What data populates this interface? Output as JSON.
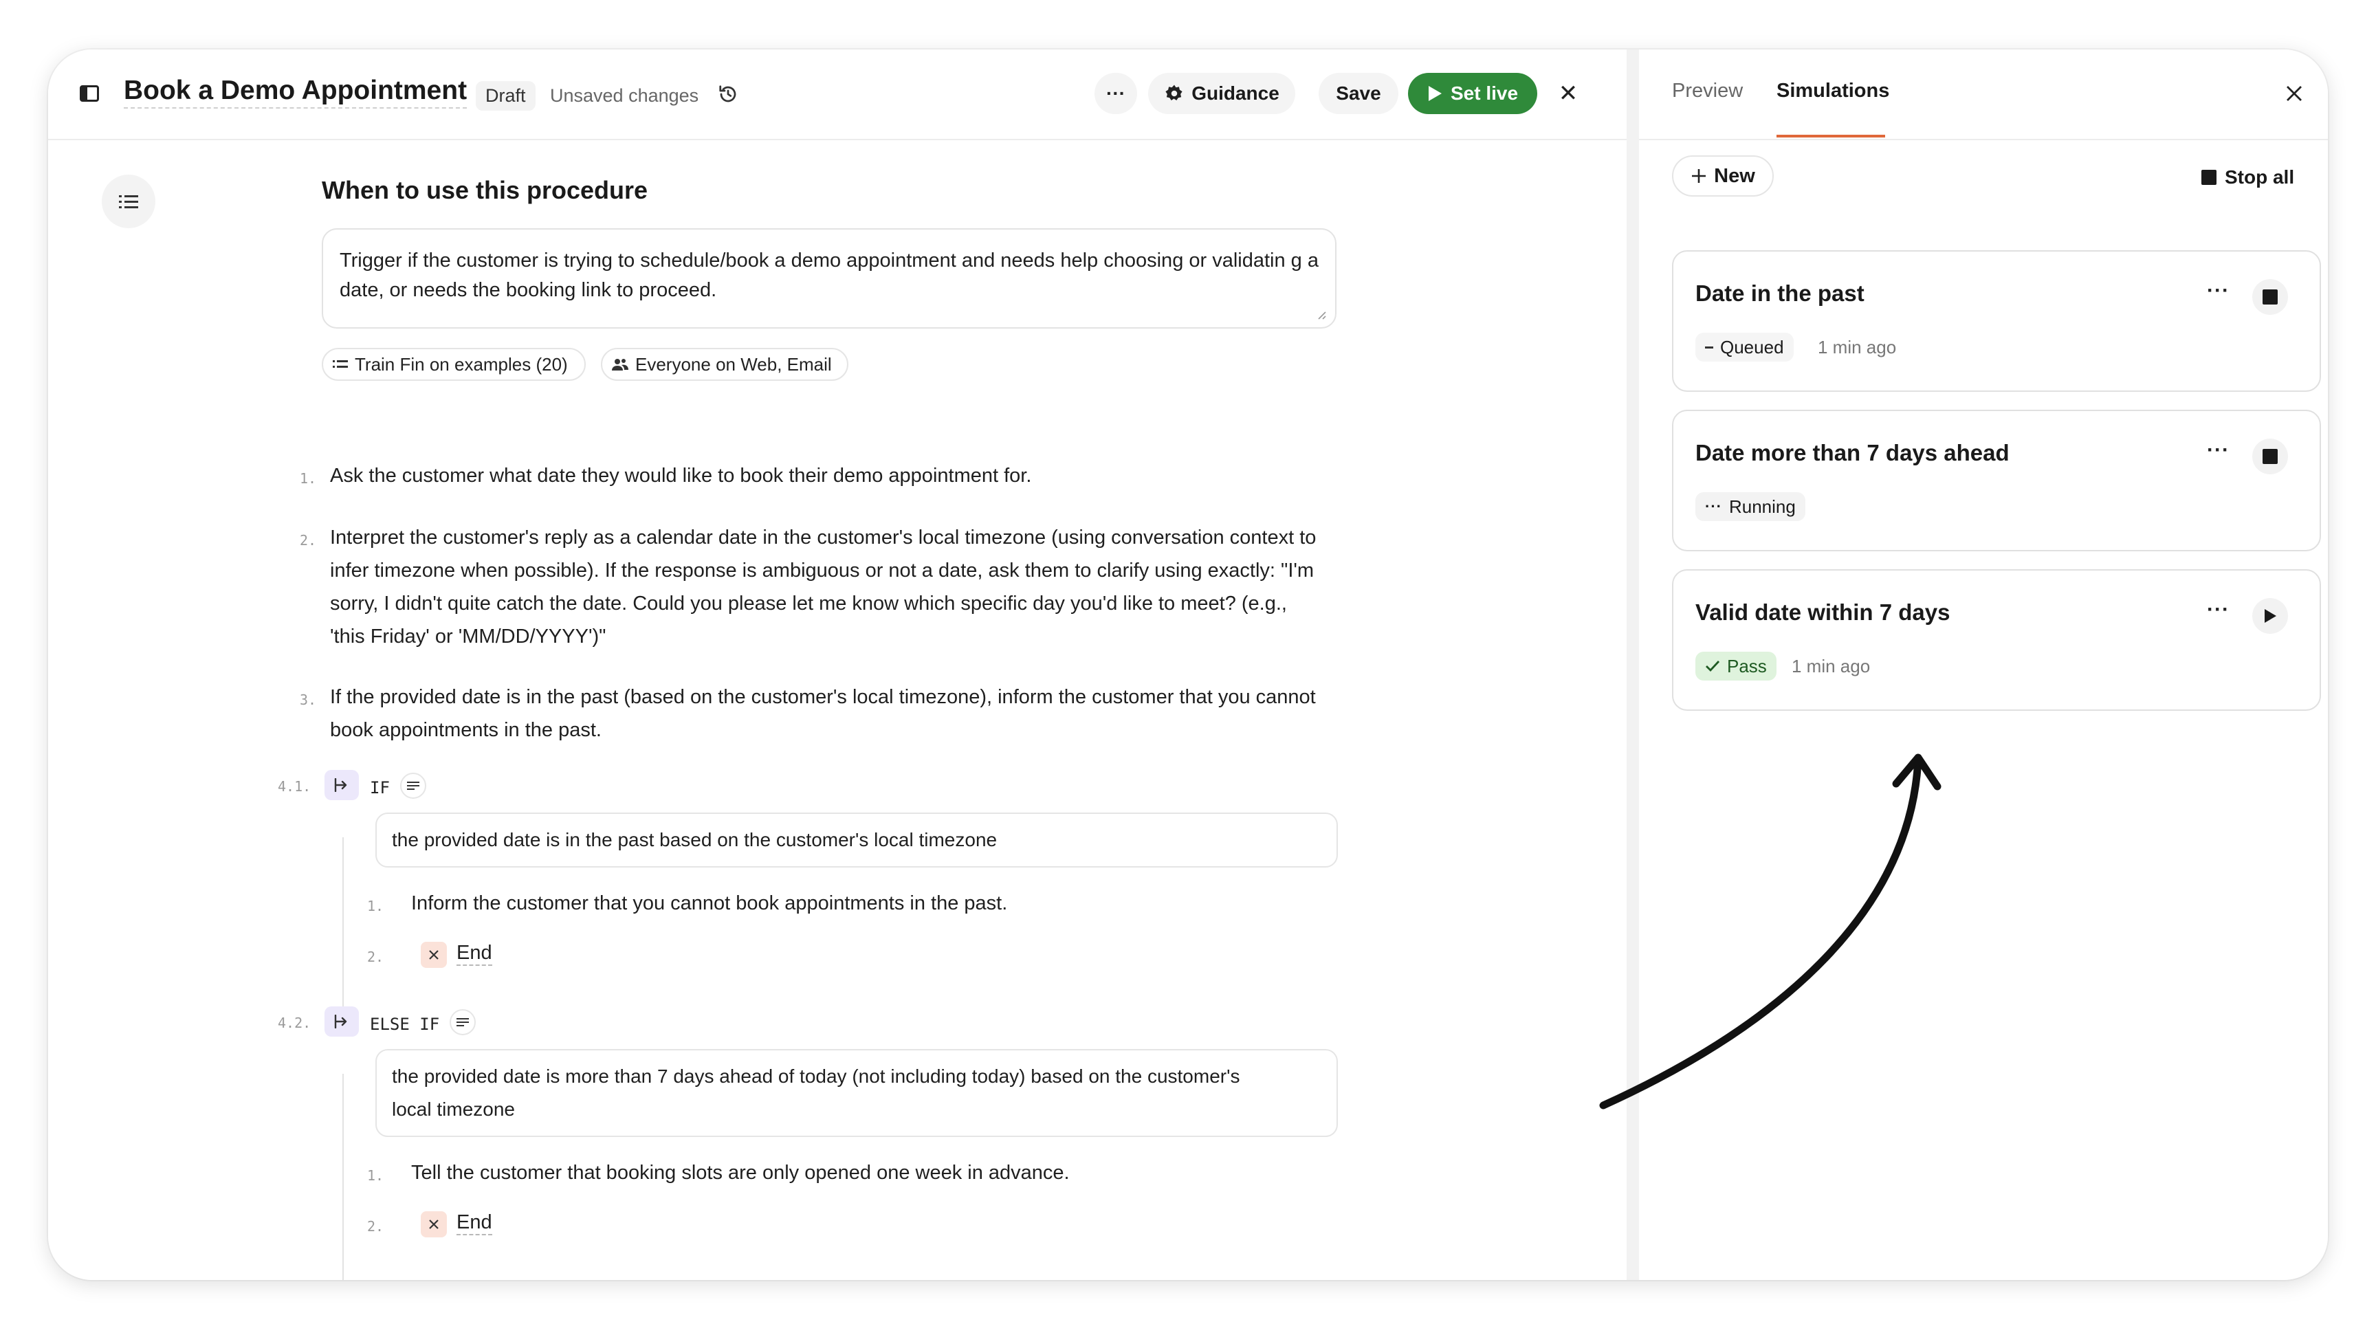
{
  "header": {
    "title": "Book a Demo Appointment",
    "status_badge": "Draft",
    "unsaved": "Unsaved changes",
    "more_label": "···",
    "guidance_label": "Guidance",
    "save_label": "Save",
    "set_live_label": "Set live",
    "close_label": "✕",
    "accent_green": "#2f8a3a"
  },
  "procedure": {
    "when_heading": "When to use this procedure",
    "trigger_text": "Trigger if the customer is trying to schedule/book a demo appointment and needs help choosing or validatin g a date, or needs the booking link to proceed.",
    "chip_train": "Train Fin on examples (20)",
    "chip_audience": "Everyone on Web, Email",
    "steps": [
      {
        "num": "1.",
        "text": "Ask the customer what date they would like to book their demo appointment for."
      },
      {
        "num": "2.",
        "lines": [
          "Interpret the customer's reply as a calendar date in the customer's local timezone (using conversation context to",
          "infer timezone when possible). If the response is ambiguous or not a date, ask them to clarify using exactly: \"I'm",
          "sorry, I didn't quite catch the date. Could you please let me know which specific day you'd like to meet? (e.g.,",
          "'this Friday' or 'MM/DD/YYYY')\""
        ]
      },
      {
        "num": "3.",
        "lines": [
          "If the provided date is in the past (based on the customer's local timezone), inform the customer that you cannot",
          "book appointments in the past."
        ]
      }
    ],
    "branches": [
      {
        "num": "4.1.",
        "keyword": "IF",
        "condition": "the provided date is in the past based on the customer's local timezone",
        "sub1_num": "1.",
        "sub1_text": "Inform the customer that you cannot book appointments in the past.",
        "sub2_num": "2.",
        "end_label": "End"
      },
      {
        "num": "4.2.",
        "keyword": "ELSE IF",
        "condition_lines": [
          "the provided date is more than 7 days ahead of today (not including today) based on the customer's",
          "local timezone"
        ],
        "sub1_num": "1.",
        "sub1_text": "Tell the customer that booking slots are only opened one week in advance.",
        "sub2_num": "2.",
        "end_label": "End"
      }
    ]
  },
  "sidebar": {
    "tabs": [
      {
        "label": "Preview"
      },
      {
        "label": "Simulations"
      }
    ],
    "active_tab": "Simulations",
    "tab_accent": "#e0683a",
    "new_label": "New",
    "stop_all_label": "Stop all",
    "simulations": [
      {
        "title": "Date in the past",
        "status": "Queued",
        "status_icon": "dash-icon",
        "ago": "1 min ago",
        "action_icon": "stop-icon"
      },
      {
        "title": "Date more than 7 days ahead",
        "status": "Running",
        "status_icon": "ellipsis-icon",
        "ago": "",
        "action_icon": "stop-icon"
      },
      {
        "title": "Valid date within 7 days",
        "status": "Pass",
        "status_icon": "check-icon",
        "ago": "1 min ago",
        "action_icon": "play-icon"
      }
    ]
  }
}
